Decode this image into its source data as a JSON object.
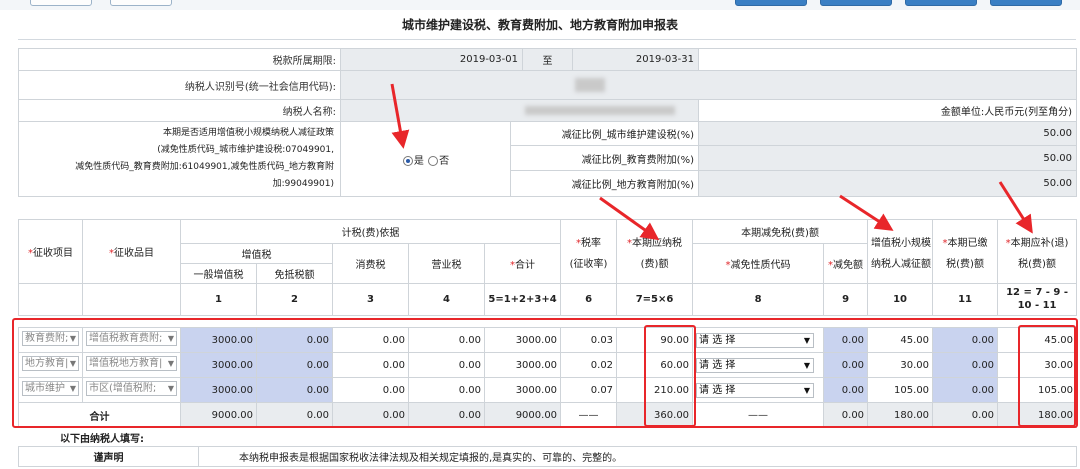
{
  "title": "城市维护建设税、教育费附加、地方教育附加申报表",
  "info": {
    "period_label": "税款所属期限:",
    "period_start": "2019-03-01",
    "period_to": "至",
    "period_end": "2019-03-31",
    "taxpayer_id_label": "纳税人识别号(统一社会信用代码):",
    "taxpayer_name_label": "纳税人名称:",
    "amount_unit": "金额单位:人民币元(列至角分)",
    "policy_line1": "本期是否适用增值税小规模纳税人减征政策",
    "policy_line2": "(减免性质代码_城市维护建设税:07049901,",
    "policy_line3": "减免性质代码_教育费附加:61049901,减免性质代码_地方教育附",
    "policy_line4": "加:99049901)",
    "yes": "是",
    "no": "否",
    "ratios": [
      {
        "label": "减征比例_城市维护建设税(%)",
        "value": "50.00"
      },
      {
        "label": "减征比例_教育费附加(%)",
        "value": "50.00"
      },
      {
        "label": "减征比例_地方教育附加(%)",
        "value": "50.00"
      }
    ]
  },
  "headers": {
    "item": "征收项目",
    "subitem": "征收品目",
    "basis": "计税(费)依据",
    "vat": "增值税",
    "general_vat": "一般增值税",
    "exempt_offset": "免抵税额",
    "consumption": "消费税",
    "business": "营业税",
    "total": "合计",
    "rate": "税率",
    "rate2": "(征收率)",
    "payable": "本期应纳税",
    "payable2": "(费)额",
    "reduction": "本期减免税(费)额",
    "reduction_code": "减免性质代码",
    "reduction_amount": "减免额",
    "small_vat": "增值税小规模",
    "small_vat2": "纳税人减征额",
    "paid": "本期已缴",
    "paid2": "税(费)额",
    "refund": "本期应补(退)",
    "refund2": "税(费)额",
    "star": "*",
    "col_nums": [
      "1",
      "2",
      "3",
      "4",
      "5=1+2+3+4",
      "6",
      "7=5×6",
      "8",
      "9",
      "10",
      "11",
      "12 = 7 - 9 - 10 - 11"
    ]
  },
  "rows": [
    {
      "item": "教育费附;",
      "subitem": "增值税教育费附;",
      "c1": "3000.00",
      "c2": "0.00",
      "c3": "0.00",
      "c4": "0.00",
      "c5": "3000.00",
      "c6": "0.03",
      "c7": "90.00",
      "code": "请 选 择",
      "c9": "0.00",
      "c10": "45.00",
      "c11": "0.00",
      "c12": "45.00"
    },
    {
      "item": "地方教育|",
      "subitem": "增值税地方教育|",
      "c1": "3000.00",
      "c2": "0.00",
      "c3": "0.00",
      "c4": "0.00",
      "c5": "3000.00",
      "c6": "0.02",
      "c7": "60.00",
      "code": "请 选 择",
      "c9": "0.00",
      "c10": "30.00",
      "c11": "0.00",
      "c12": "30.00"
    },
    {
      "item": "城市维护",
      "subitem": "市区(增值税附;",
      "c1": "3000.00",
      "c2": "0.00",
      "c3": "0.00",
      "c4": "0.00",
      "c5": "3000.00",
      "c6": "0.07",
      "c7": "210.00",
      "code": "请 选 择",
      "c9": "0.00",
      "c10": "105.00",
      "c11": "0.00",
      "c12": "105.00"
    }
  ],
  "totals": {
    "label": "合计",
    "c1": "9000.00",
    "c2": "0.00",
    "c3": "0.00",
    "c4": "0.00",
    "c5": "9000.00",
    "c6": "——",
    "c7": "360.00",
    "code": "——",
    "c9": "0.00",
    "c10": "180.00",
    "c11": "0.00",
    "c12": "180.00"
  },
  "footer": {
    "fill_by": "以下由纳税人填写:",
    "declaration_label": "谨声明",
    "declaration_text": "本纳税申报表是根据国家税收法律法规及相关规定填报的,是真实的、可靠的、完整的。"
  },
  "colors": {
    "highlight_red": "#e8262a",
    "input_blue": "#c9d3ef",
    "readonly_gray": "#e9ecef"
  }
}
